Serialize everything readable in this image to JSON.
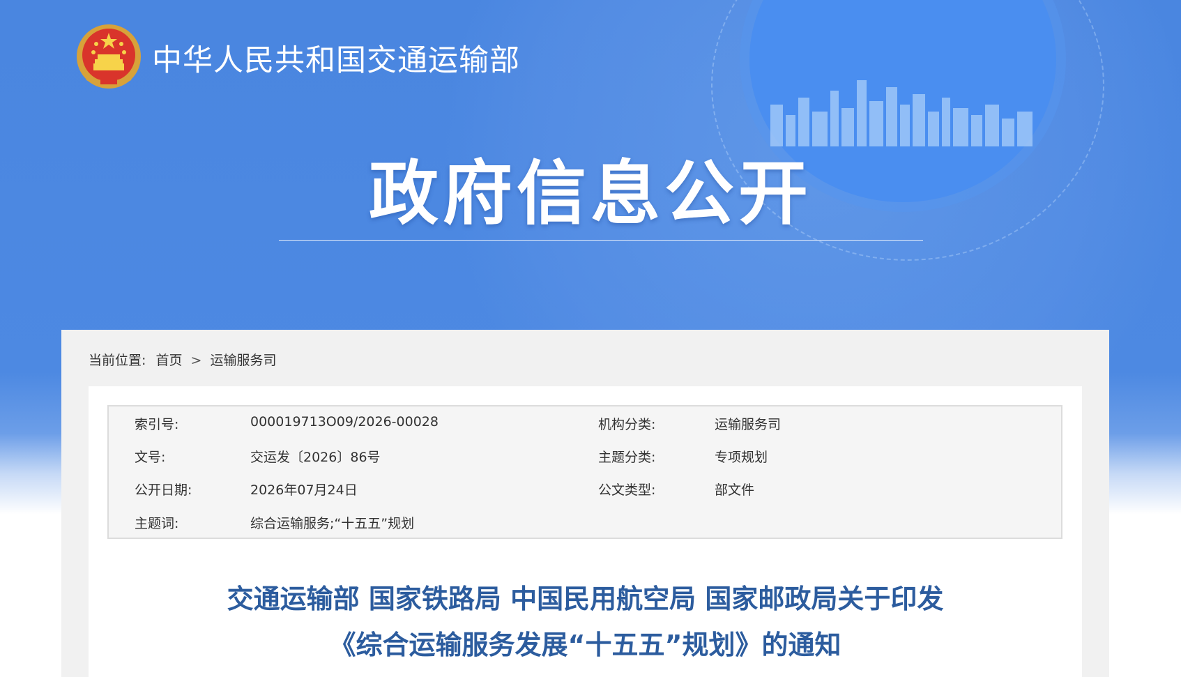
{
  "header": {
    "ministry_name": "中华人民共和国交通运输部",
    "section_title": "政府信息公开"
  },
  "breadcrumb": {
    "label": "当前位置:",
    "home": "首页",
    "separator": ">",
    "current": "运输服务司"
  },
  "meta": {
    "index_no_label": "索引号:",
    "index_no_value": "000019713O09/2026-00028",
    "org_label": "机构分类:",
    "org_value": "运输服务司",
    "doc_no_label": "文号:",
    "doc_no_value": "交运发〔2026〕86号",
    "topic_label": "主题分类:",
    "topic_value": "专项规划",
    "date_label": "公开日期:",
    "date_value": "2026年07月24日",
    "type_label": "公文类型:",
    "type_value": "部文件",
    "keywords_label": "主题词:",
    "keywords_value": "综合运输服务;“十五五”规划"
  },
  "document": {
    "title_line1": "交通运输部 国家铁路局 中国民用航空局 国家邮政局关于印发",
    "title_line2": "《综合运输服务发展“十五五”规划》的通知"
  },
  "colors": {
    "banner_blue": "#4a86e0",
    "title_blue": "#2c5c9e",
    "panel_gray": "#f1f1f1"
  }
}
